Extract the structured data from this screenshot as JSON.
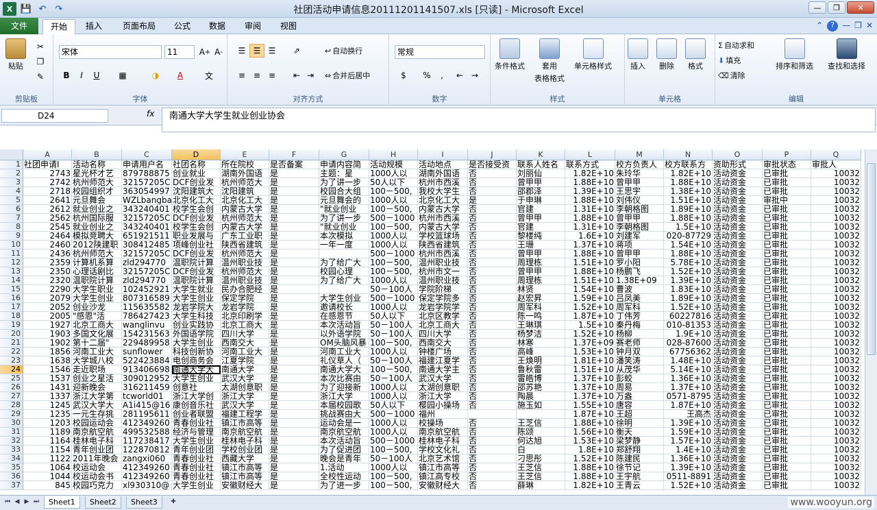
{
  "window": {
    "title": "社团活动申请信息20111201141507.xls  [只读]  -  Microsoft Excel"
  },
  "tabs": [
    "文件",
    "开始",
    "插入",
    "页面布局",
    "公式",
    "数据",
    "审阅",
    "视图"
  ],
  "ribbon": {
    "clipboard": {
      "label": "剪贴板",
      "paste": "粘贴"
    },
    "font": {
      "label": "字体",
      "family": "宋体",
      "size": "11"
    },
    "align": {
      "label": "对齐方式",
      "wrap": "自动换行",
      "merge": "合并后居中"
    },
    "number": {
      "label": "数字",
      "format": "常规",
      "currency": "$",
      "percent": "%"
    },
    "styles": {
      "label": "样式",
      "cond": "条件格式",
      "table": "套用",
      "table2": "表格格式",
      "cell": "单元格样式"
    },
    "cells": {
      "label": "单元格",
      "insert": "插入",
      "delete": "删除",
      "format": "格式"
    },
    "edit": {
      "label": "编辑",
      "sum": "自动求和",
      "fill": "填充",
      "clear": "清除",
      "sort": "排序和筛选",
      "find": "查找和选择"
    }
  },
  "formula": {
    "namebox": "D24",
    "fx": "fx",
    "content": "南通大学大学生就业创业协会"
  },
  "columns": [
    "A",
    "B",
    "C",
    "D",
    "E",
    "F",
    "G",
    "H",
    "I",
    "J",
    "K",
    "L",
    "M",
    "N",
    "O",
    "P",
    "Q"
  ],
  "header_row": [
    "社团申请I",
    "活动名称",
    "申请用户名",
    "社团名称",
    "所在院校",
    "是否备案",
    "申请内容简",
    "活动规模",
    "活动地点",
    "是否接受资",
    "联系人姓名",
    "联系方式",
    "校方负责人",
    "校方联系方",
    "资助形式",
    "审批状态",
    "审批人"
  ],
  "rows": [
    [
      "2743",
      "星光杯才艺",
      "879788875",
      "创业就业",
      "湖南外国语",
      "是",
      "主题：星",
      "1000人以",
      "湖南外国语",
      "否",
      "刘丽仙",
      "1.82E+10",
      "朱玲华",
      "1.82E+10",
      "活动资金",
      "已审批",
      "10032"
    ],
    [
      "2742",
      "杭州师范大",
      "32157205C",
      "DCF创业发",
      "杭州师范大",
      "是",
      "为了讲一步",
      "50人以下",
      "杭州市西溪",
      "否",
      "曾甲甲",
      "1.88E+10",
      "曾甲甲",
      "1.88E+10",
      "活动资金",
      "已审批",
      "10032"
    ],
    [
      "2718",
      "校园组织才",
      "363054997",
      "沈阳建筑大",
      "沈阳建筑",
      "是",
      "校园合大组",
      "100－500,",
      "我校大学生",
      "否",
      "邵郡泽",
      "1.39E+10",
      "王思宇",
      "1.38E+10",
      "活动资金",
      "已审批",
      "10032"
    ],
    [
      "2641",
      "元旦舞会",
      "WZLbangba",
      "北京化工大",
      "北京化工大",
      "是",
      "元旦舞会的",
      "1000人以",
      "北京化工大",
      "是",
      "于申琳",
      "1.88E+10",
      "刘伟仪",
      "1.51E+10",
      "活动资金",
      "审批中",
      "10032"
    ],
    [
      "2612",
      "就业创业之",
      "343240401",
      "校学生会创",
      "内蒙古大学",
      "是",
      "\"就业创业",
      "100－500,",
      "内蒙古大学",
      "否",
      "官建",
      "1.31E+10",
      "李朝格图",
      "1.89E+10",
      "活动资金",
      "已审批",
      "10032"
    ],
    [
      "2562",
      "杭州国际服",
      "32157205C",
      "DCF创业发",
      "杭州师范大",
      "是",
      "为了讲一步",
      "500－1000",
      "杭州市西溪",
      "否",
      "曾甲甲",
      "1.88E+10",
      "曾甲甲",
      "1.88E+10",
      "活动资金",
      "已审批",
      "10032"
    ],
    [
      "2545",
      "就业创业之",
      "343240401",
      "校学生会创",
      "内蒙古大学",
      "是",
      "\"就业创业",
      "100－500,",
      "内蒙古大学",
      "否",
      "官建",
      "1.31E+10",
      "李朝格图",
      "1.5E+10",
      "活动资金",
      "已审批",
      "10032"
    ],
    [
      "2464",
      "模拟竞聘大",
      "651921511",
      "职业发展与",
      "广东工业职",
      "是",
      "本次模拟",
      "1000人以",
      "学校篮球场",
      "否",
      "黎楼纯",
      "1.6E+10",
      "刘建军",
      "020-87729",
      "活动资金",
      "已审批",
      "10032"
    ],
    [
      "2460",
      "2012陕建职",
      "308412485",
      "项峰创业社",
      "陕西省建筑",
      "是",
      "一年一度",
      "1000人以",
      "陕西省建筑",
      "否",
      "王珊",
      "1.37E+10",
      "蒋项",
      "1.54E+10",
      "活动资金",
      "已审批",
      "10032"
    ],
    [
      "2436",
      "杭州师范大",
      "32157205C",
      "DCF创业发",
      "杭州师范大",
      "是",
      "",
      "500－1000",
      "杭州市西溪",
      "否",
      "曾甲甲",
      "1.88E+10",
      "曾甲甲",
      "1.88E+10",
      "活动资金",
      "已审批",
      "10032"
    ],
    [
      "2359",
      "计算机系算",
      "zld294770",
      "温职院计算",
      "温州职业技",
      "是",
      "为了给广大",
      "100－500,",
      "温州职业技",
      "否",
      "周理栋",
      "1.51E+10",
      "罗小阳",
      "5.78E+10",
      "活动资金",
      "已审批",
      "10032"
    ],
    [
      "2350",
      "心理话剧比",
      "32157205C",
      "DCF创业发",
      "杭州师范大",
      "是",
      "校园心理",
      "100－500,",
      "杭州市文一",
      "否",
      "曾甲甲",
      "1.88E+10",
      "杨鹏飞",
      "1.52E+10",
      "活动资金",
      "已审批",
      "10032"
    ],
    [
      "2320",
      "温职院计算",
      "zld294770",
      "温职院计算",
      "温州职业技",
      "是",
      "为了给广大",
      "1000人以",
      "温州职业技",
      "否",
      "周理栋",
      "1.51E+10",
      "1.38E+09",
      "1.39E+10",
      "活动资金",
      "已审批",
      "10032"
    ],
    [
      "2290",
      "大学生职业",
      "102452921",
      "大学生就业",
      "民办合肥经",
      "是",
      "",
      "50－100人",
      "学院阶梯",
      "否",
      "林贤",
      "1.54E+10",
      "曹波",
      "1.83E+10",
      "活动资金",
      "已审批",
      "10032"
    ],
    [
      "2079",
      "大学生创业",
      "807316589",
      "大学生创业",
      "保定学院",
      "是",
      "大学生创业",
      "500－1000",
      "保定学院多",
      "否",
      "赵宏昇",
      "1.59E+10",
      "吕凤美",
      "1.89E+10",
      "活动资金",
      "已审批",
      "10032"
    ],
    [
      "2052",
      "创业沙龙",
      "115635582",
      "龙岩学院大",
      "龙岩学院",
      "是",
      "邀请校长",
      "1000人以",
      "龙岩学院学",
      "否",
      "周军科",
      "1.52E+10",
      "周军科",
      "1.52E+10",
      "活动资金",
      "已审批",
      "10032"
    ],
    [
      "2005",
      "\"感恩\"活",
      "786427423",
      "大学生科技",
      "北京印刷学",
      "是",
      "在感恩节",
      "50人以下",
      "北京区教学",
      "否",
      "陈一鸣",
      "1.87E+10",
      "丁伟芳",
      "60227816",
      "活动资金",
      "已审批",
      "10032"
    ],
    [
      "1927",
      "北京工商大",
      "wanglinvu",
      "创业实践协",
      "北京工商大",
      "是",
      "本次活动旨",
      "50－100人",
      "北京工商大",
      "否",
      "王琳琪",
      "1.5E+10",
      "秦丹梅",
      "010-81353",
      "活动资金",
      "已审批",
      "10032"
    ],
    [
      "1903",
      "多国文化展",
      "154231563",
      "外国语学院",
      "四川大学",
      "是",
      "以外语学院",
      "50－100人",
      "四川大学",
      "否",
      "杨梦洁",
      "1.52E+10",
      "杨柳",
      "1.9E+10",
      "活动资金",
      "已审批",
      "10032"
    ],
    [
      "1902",
      "第十二届\"",
      "229489958",
      "大学生创业",
      "西南交大",
      "是",
      "OM头脑风暴",
      "100－500,",
      "西南交大",
      "否",
      "林寒",
      "1.37E+09",
      "赛老师",
      "028-87600",
      "活动资金",
      "已审批",
      "10032"
    ],
    [
      "1856",
      "河南工业大",
      "sunflower",
      "科技创新协",
      "河南工业大",
      "是",
      "河南工业大",
      "1000人以",
      "钟楼广场",
      "否",
      "高峰",
      "1.53E+10",
      "钟月双",
      "67756362",
      "活动资金",
      "已审批",
      "10032"
    ],
    [
      "1638",
      "大学城八校",
      "522423884",
      "电创商务会",
      "江夏学院",
      "是",
      "礼仪草人（",
      "50－100人",
      "福建江夏学",
      "否",
      "王焕明",
      "1.81E+10",
      "潘笑涛",
      "1.48E+10",
      "活动资金",
      "已审批",
      "10032"
    ],
    [
      "1546",
      "走近职场",
      "913406698",
      "南通大学大",
      "南通大学",
      "是",
      "南通大学大",
      "100－500,",
      "南通大学主",
      "否",
      "鲁秋雷",
      "1.51E+10",
      "从茂华",
      "5.14E+10",
      "活动资金",
      "已审批",
      "10032"
    ],
    [
      "1537",
      "创业之星活",
      "309012952",
      "大学生创业",
      "武汉大学",
      "是",
      "本次比赛由",
      "50－100人",
      "武汉大学",
      "否",
      "雷皓博",
      "1.37E+10",
      "彭蛟",
      "1.36E+10",
      "活动资金",
      "已审批",
      "10032"
    ],
    [
      "1431",
      "迎新晚会",
      "316211459",
      "创意社",
      "太湖创意职",
      "是",
      "为了迎接新",
      "1000人以",
      "太湖创意职",
      "否",
      "邵苏艳",
      "1.37E+10",
      "周易",
      "1.37E+10",
      "活动资金",
      "已审批",
      "10032"
    ],
    [
      "1337",
      "浙江大学第",
      "tcworld01",
      "浙江大学创",
      "浙江大学",
      "是",
      "浙江大学",
      "1000人以",
      "浙江大学",
      "否",
      "陶晨",
      "1.37E+10",
      "万盎",
      "0571-8795",
      "活动资金",
      "已审批",
      "10032"
    ],
    [
      "1245",
      "武汉大学大",
      "A1i415@16",
      "康创音乐社",
      "武汉大学",
      "是",
      "本届校园歌",
      "50人以下",
      "樱园小操场",
      "否",
      "施玉如",
      "1.55E+10",
      "唐容",
      "1.87E+10",
      "活动资金",
      "已审批",
      "10032"
    ],
    [
      "1235",
      "一元生存挑",
      "281195611",
      "创业者联盟",
      "福建工程学",
      "是",
      "挑战赛由大",
      "500－1000",
      "福州",
      "",
      "",
      "1.87E+10",
      "王超",
      "王高杰",
      "活动资金",
      "已审批",
      "10032"
    ],
    [
      "1203",
      "校园运动会",
      "412349260",
      "青春创业社",
      "镇江市高等",
      "是",
      "运动会是一",
      "1000人以",
      "校操场",
      "否",
      "王芝信",
      "1.88E+10",
      "徐明",
      "1.39E+10",
      "活动资金",
      "已审批",
      "10032"
    ],
    [
      "1189",
      "南京航空航",
      "499532588",
      "经济与管理",
      "南京航空航",
      "是",
      "南京航空航",
      "1000人以",
      "南京航空航",
      "否",
      "陈颂",
      "1.56E+10",
      "衡天",
      "1.59E+10",
      "活动资金",
      "已审批",
      "10032"
    ],
    [
      "1164",
      "桂林电子科",
      "117238417",
      "大学生创业",
      "桂林电子科",
      "是",
      "本次活动旨",
      "500－1000",
      "桂林电子科",
      "否",
      "何达旭",
      "1.53E+10",
      "梁梦静",
      "1.57E+10",
      "活动资金",
      "已审批",
      "10032"
    ],
    [
      "1154",
      "青年创业团",
      "122870812",
      "青年创业团",
      "学校创业团",
      "是",
      "为了促进团",
      "100－500,",
      "学校文化礼",
      "否",
      "白",
      "1.8E+10",
      "郑舒翔",
      "1.4E+10",
      "活动资金",
      "已审批",
      "10032"
    ],
    [
      "1122",
      "2011年晚会",
      "zangxi060",
      "青春创业社",
      "西藏大学",
      "是",
      "晚会是青年",
      "50－100人",
      "北京艺术馆",
      "否",
      "刁思彤",
      "1.52E+10",
      "陈建民",
      "1.36E+10",
      "活动资金",
      "已审批",
      "10032"
    ],
    [
      "1064",
      "校运动会",
      "412349260",
      "青春创业社",
      "镇江市高等",
      "是",
      "1.活动",
      "1000人以",
      "镇江市高等",
      "否",
      "王芝信",
      "1.88E+10",
      "徐节记",
      "1.39E+10",
      "活动资金",
      "已审批",
      "10032"
    ],
    [
      "1044",
      "校运动会书",
      "412349260",
      "青春创业社",
      "镇江市高等",
      "是",
      "全校性运动",
      "100－500,",
      "镇江高专校",
      "否",
      "王芝信",
      "1.88E+10",
      "王宇航",
      "0511-8891",
      "活动资金",
      "已审批",
      "10032"
    ],
    [
      "845",
      "校园巧克力",
      "xl930310@",
      "大学生创业",
      "安徽财经大",
      "是",
      "为了进一步",
      "100－500,",
      "安徽财经大",
      "否",
      "薛琳",
      "1.82E+10",
      "王青云",
      "1.52E+10",
      "活动资金",
      "已审批",
      "10032"
    ]
  ],
  "sheets": [
    "Sheet1",
    "Sheet2",
    "Sheet3"
  ],
  "watermark": "www.wooyun.org"
}
